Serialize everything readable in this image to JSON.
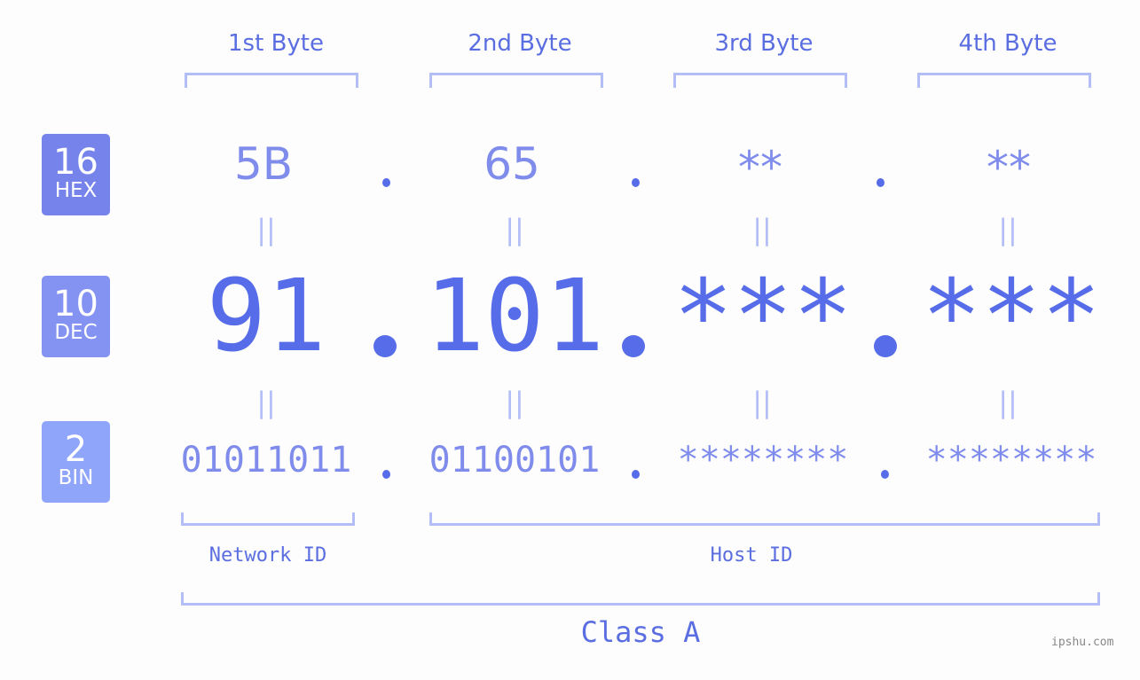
{
  "byte_headers": [
    "1st Byte",
    "2nd Byte",
    "3rd Byte",
    "4th Byte"
  ],
  "rows": {
    "hex": {
      "base": "16",
      "label": "HEX",
      "values": [
        "5B",
        "65",
        "**",
        "**"
      ]
    },
    "dec": {
      "base": "10",
      "label": "DEC",
      "values": [
        "91",
        "101",
        "***",
        "***"
      ]
    },
    "bin": {
      "base": "2",
      "label": "BIN",
      "values": [
        "01011011",
        "01100101",
        "********",
        "********"
      ]
    }
  },
  "equals_symbol": "||",
  "segments": {
    "network": "Network ID",
    "host": "Host ID"
  },
  "ip_class": "Class A",
  "watermark": "ipshu.com",
  "colors": {
    "hex_badge": "#7583ea",
    "dec_badge": "#8492f1",
    "bin_badge": "#8fa5fa",
    "accent": "#566ce9",
    "bracket": "#b3bdf6"
  }
}
